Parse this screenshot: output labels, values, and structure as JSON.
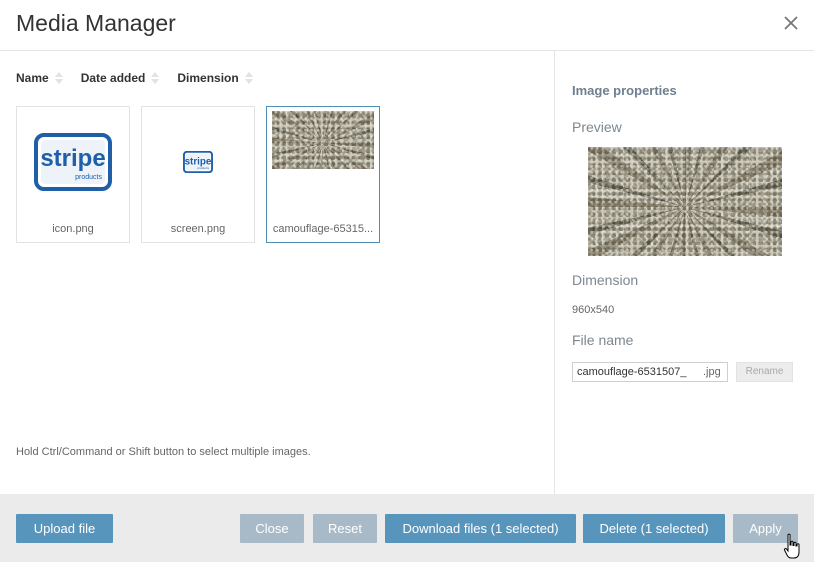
{
  "dialog": {
    "title": "Media Manager",
    "close_icon": "close-icon"
  },
  "sort": {
    "items": [
      {
        "label": "Name"
      },
      {
        "label": "Date added"
      },
      {
        "label": "Dimension"
      }
    ]
  },
  "files": [
    {
      "name": "icon.png",
      "selected": false,
      "logo_text": "stripe",
      "logo_sub": "products"
    },
    {
      "name": "screen.png",
      "selected": false,
      "logo_text": "stripe",
      "logo_sub": "products"
    },
    {
      "name": "camouflage-65315...",
      "selected": true
    }
  ],
  "hint": "Hold Ctrl/Command or Shift button to select multiple images.",
  "properties": {
    "heading": "Image properties",
    "preview_label": "Preview",
    "dimension_label": "Dimension",
    "dimension_value": "960x540",
    "filename_label": "File name",
    "filename_value": "camouflage-6531507_",
    "filename_ext": ".jpg",
    "rename_label": "Rename"
  },
  "footer": {
    "upload_label": "Upload file",
    "close_label": "Close",
    "reset_label": "Reset",
    "download_label": "Download files (1 selected)",
    "delete_label": "Delete (1 selected)",
    "apply_label": "Apply"
  },
  "colors": {
    "primary": "#5895bc",
    "muted": "#a8bac7",
    "stripe_blue": "#1f5fa8"
  }
}
